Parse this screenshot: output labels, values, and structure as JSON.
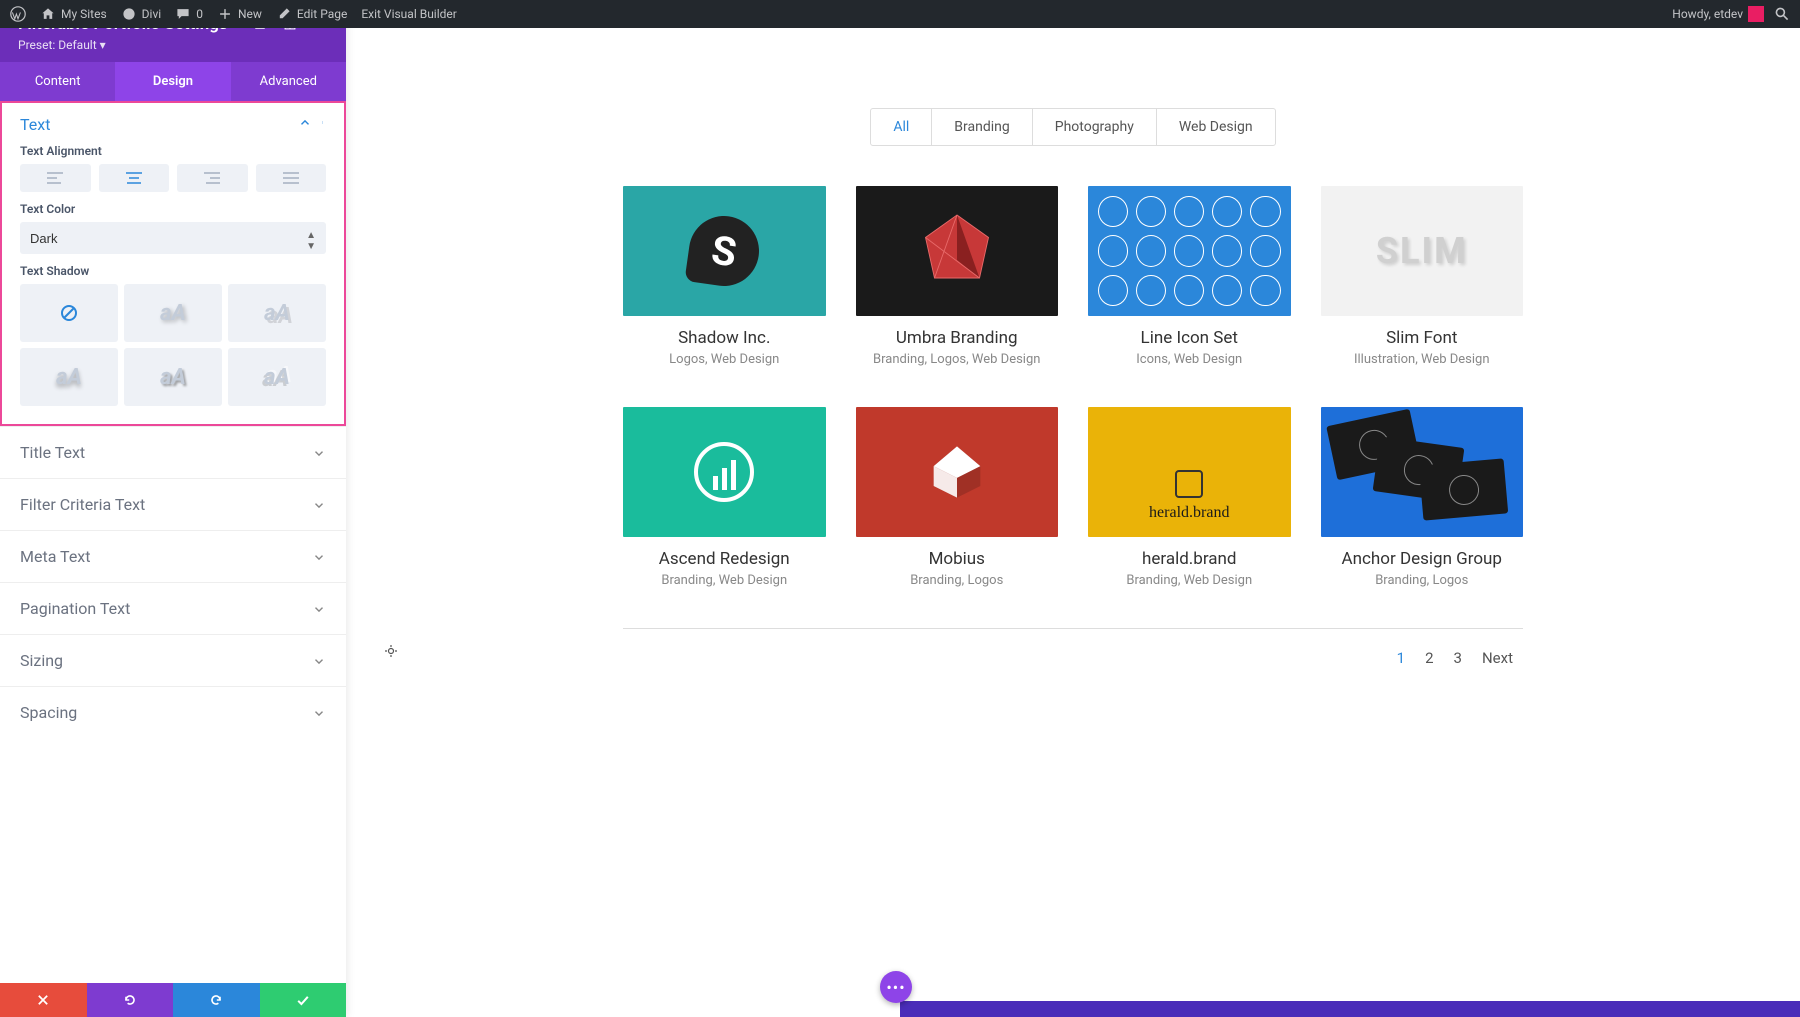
{
  "adminbar": {
    "mysites": "My Sites",
    "divi": "Divi",
    "comments": "0",
    "new": "New",
    "edit": "Edit Page",
    "exit": "Exit Visual Builder",
    "howdy": "Howdy, etdev"
  },
  "panel": {
    "title": "Filterable Portfolio Settings",
    "preset": "Preset: Default",
    "tabs": {
      "content": "Content",
      "design": "Design",
      "advanced": "Advanced"
    },
    "text": {
      "heading": "Text",
      "alignment_label": "Text Alignment",
      "color_label": "Text Color",
      "color_value": "Dark",
      "shadow_label": "Text Shadow",
      "shadow_sample": "aA"
    },
    "accordion": {
      "title_text": "Title Text",
      "filter_criteria": "Filter Criteria Text",
      "meta_text": "Meta Text",
      "pagination_text": "Pagination Text",
      "sizing": "Sizing",
      "spacing": "Spacing"
    }
  },
  "filters": {
    "all": "All",
    "branding": "Branding",
    "photography": "Photography",
    "webdesign": "Web Design"
  },
  "items": [
    {
      "title": "Shadow Inc.",
      "meta": "Logos, Web Design"
    },
    {
      "title": "Umbra Branding",
      "meta": "Branding, Logos, Web Design"
    },
    {
      "title": "Line Icon Set",
      "meta": "Icons, Web Design"
    },
    {
      "title": "Slim Font",
      "meta": "Illustration, Web Design"
    },
    {
      "title": "Ascend Redesign",
      "meta": "Branding, Web Design"
    },
    {
      "title": "Mobius",
      "meta": "Branding, Logos"
    },
    {
      "title": "herald.brand",
      "meta": "Branding, Web Design"
    },
    {
      "title": "Anchor Design Group",
      "meta": "Branding, Logos"
    }
  ],
  "herald_text": "herald.brand",
  "slim_text": "SLIM",
  "pagination": {
    "p1": "1",
    "p2": "2",
    "p3": "3",
    "next": "Next"
  }
}
